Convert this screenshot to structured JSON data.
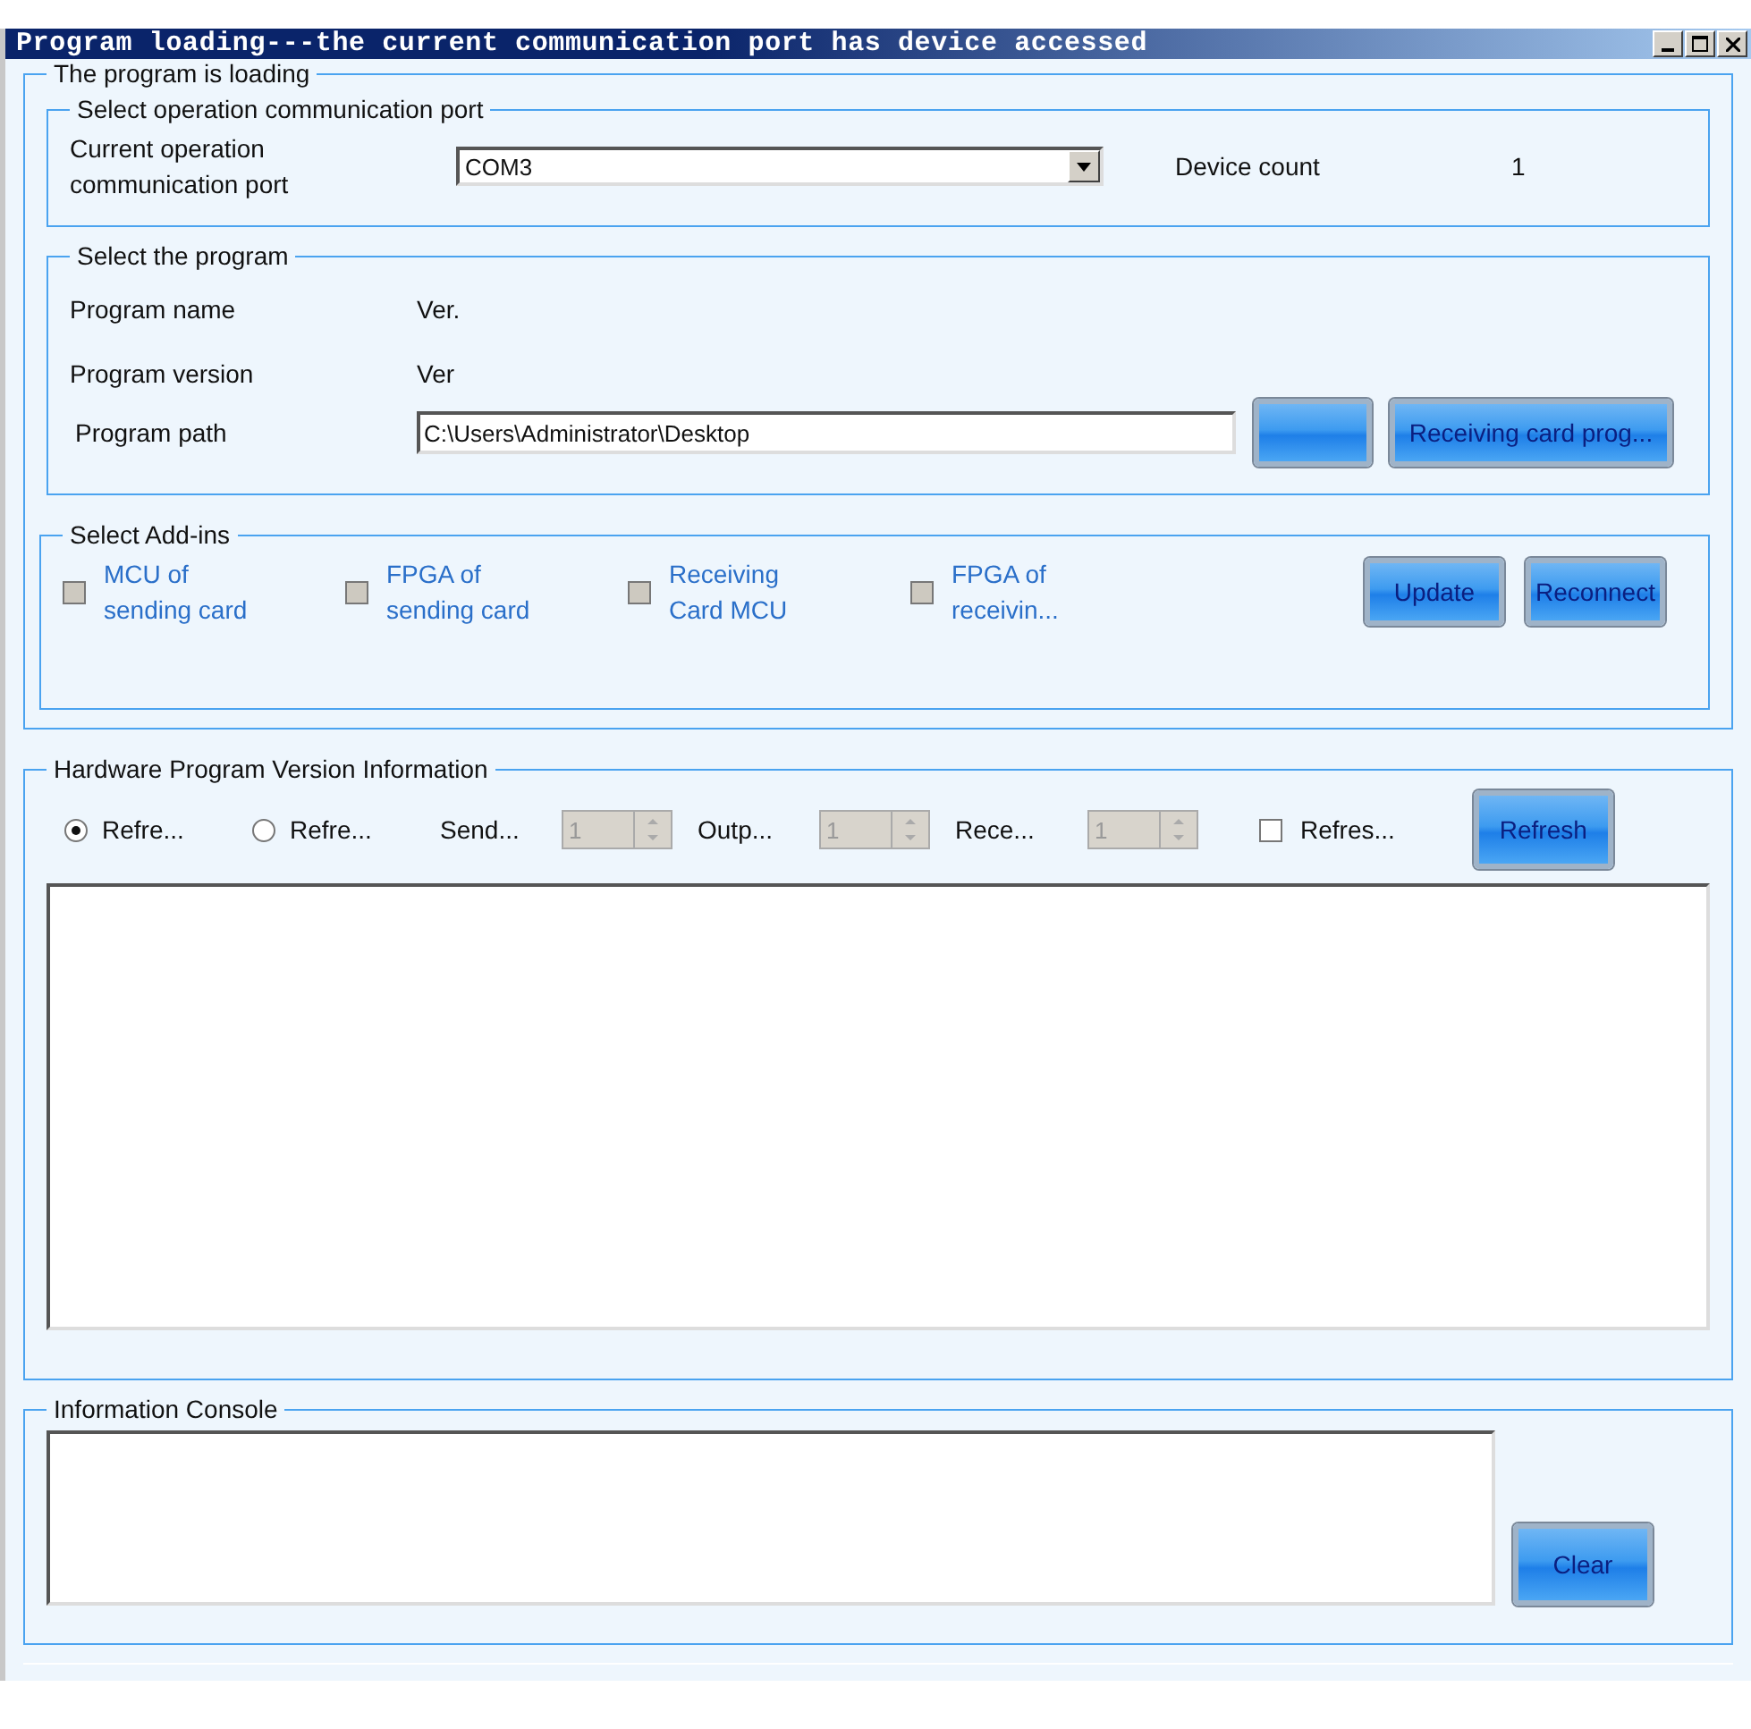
{
  "window": {
    "title": "Program loading---the current communication port has device accessed"
  },
  "loading_group": {
    "title": "The program is loading",
    "port_group": {
      "title": "Select operation communication port",
      "port_label": "Current operation\ncommunication port",
      "port_value": "COM3",
      "device_count_label": "Device count",
      "device_count": "1"
    },
    "program_group": {
      "title": "Select the program",
      "name_label": "Program name",
      "name_value": "Ver.",
      "version_label": "Program version",
      "version_value": "Ver",
      "path_label": "Program path",
      "path_value": "C:\\Users\\Administrator\\Desktop",
      "receiving_button": "Receiving card prog..."
    },
    "addins_group": {
      "title": "Select Add-ins",
      "addins": [
        {
          "label": "MCU of\nsending card",
          "checked": false,
          "disabled": true
        },
        {
          "label": "FPGA of\nsending card",
          "checked": false,
          "disabled": true
        },
        {
          "label": "Receiving\nCard MCU",
          "checked": false,
          "disabled": true
        },
        {
          "label": "FPGA of\nreceivin...",
          "checked": false,
          "disabled": true
        }
      ],
      "buttons": [
        "Update",
        "Reconnect"
      ]
    }
  },
  "hardware_group": {
    "title": "Hardware Program Version Information",
    "radios": [
      {
        "label": "Refre...",
        "selected": true
      },
      {
        "label": "Refre...",
        "selected": false
      }
    ],
    "spinners": [
      {
        "label": "Send...",
        "value": "1"
      },
      {
        "label": "Outp...",
        "value": "1"
      },
      {
        "label": "Rece...",
        "value": "1"
      }
    ],
    "checkbox": {
      "label": "Refres...",
      "checked": false
    },
    "refresh_button": "Refresh"
  },
  "console_group": {
    "title": "Information Console",
    "clear_button": "Clear"
  }
}
